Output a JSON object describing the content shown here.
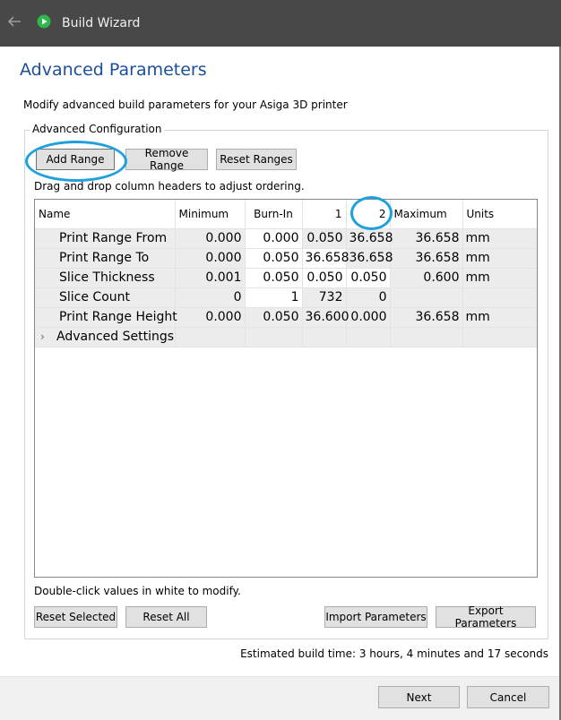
{
  "window": {
    "title": "Build Wizard"
  },
  "page": {
    "title": "Advanced Parameters",
    "subtitle": "Modify advanced build parameters for your Asiga 3D printer"
  },
  "group": {
    "legend": "Advanced Configuration"
  },
  "toolbar": {
    "add_range": "Add Range",
    "remove_range": "Remove Range",
    "reset_ranges": "Reset Ranges"
  },
  "hint_top": "Drag and drop column headers to adjust ordering.",
  "table": {
    "headers": [
      "Name",
      "Minimum",
      "Burn-In",
      "1",
      "2",
      "Maximum",
      "Units"
    ],
    "rows": [
      {
        "name": "Print Range From",
        "min": "0.000",
        "burn": "0.000",
        "c1": "0.050",
        "c2": "36.658",
        "max": "36.658",
        "units": "mm"
      },
      {
        "name": "Print Range To",
        "min": "0.000",
        "burn": "0.050",
        "c1": "36.658",
        "c2": "36.658",
        "max": "36.658",
        "units": "mm"
      },
      {
        "name": "Slice Thickness",
        "min": "0.001",
        "burn": "0.050",
        "c1": "0.050",
        "c2": "0.050",
        "max": "0.600",
        "units": "mm"
      },
      {
        "name": "Slice Count",
        "min": "0",
        "burn": "1",
        "c1": "732",
        "c2": "0",
        "max": "",
        "units": ""
      },
      {
        "name": "Print Range Height",
        "min": "0.000",
        "burn": "0.050",
        "c1": "36.600",
        "c2": "0.000",
        "max": "36.658",
        "units": "mm"
      }
    ],
    "expander_row": "Advanced Settings"
  },
  "hint_bottom": "Double-click values in white to modify.",
  "bottom_buttons": {
    "reset_selected": "Reset Selected",
    "reset_all": "Reset All",
    "import": "Import Parameters",
    "export": "Export Parameters"
  },
  "estimate": "Estimated build time: 3 hours, 4 minutes and 17 seconds",
  "footer": {
    "next": "Next",
    "cancel": "Cancel"
  },
  "colors": {
    "title_blue": "#1c4e9c",
    "highlight": "#1ea0dc",
    "titlebar": "#484848",
    "app_icon": "#2db84d"
  }
}
